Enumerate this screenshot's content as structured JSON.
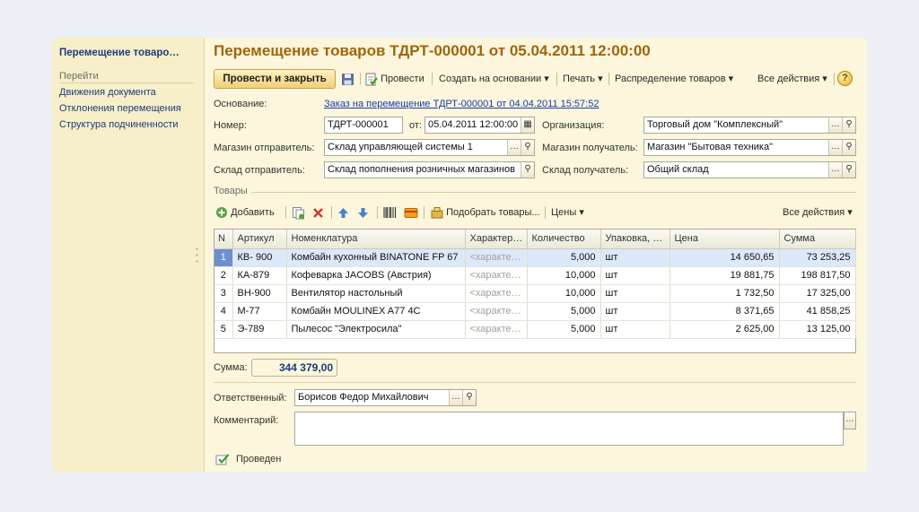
{
  "sidebar": {
    "title": "Перемещение товаро…",
    "section": "Перейти",
    "items": [
      "Движения документа",
      "Отклонения перемещения",
      "Структура подчиненности"
    ]
  },
  "window_title": "Перемещение товаров ТДРТ-000001 от 05.04.2011 12:00:00",
  "toolbar": {
    "post_close": "Провести и закрыть",
    "post": "Провести",
    "create_based": "Создать на основании",
    "print": "Печать",
    "distribution": "Распределение товаров",
    "all_actions": "Все действия",
    "help": "?"
  },
  "form": {
    "basis_label": "Основание:",
    "basis_link": "Заказ на перемещение ТДРТ-000001 от 04.04.2011 15:57:52",
    "number_label": "Номер:",
    "number_value": "ТДРТ-000001",
    "date_label": "от:",
    "date_value": "05.04.2011 12:00:00",
    "org_label": "Организация:",
    "org_value": "Торговый дом \"Комплексный\"",
    "store_from_label": "Магазин отправитель:",
    "store_from_value": "Склад управляющей системы 1",
    "store_to_label": "Магазин получатель:",
    "store_to_value": "Магазин \"Бытовая техника\"",
    "wh_from_label": "Склад отправитель:",
    "wh_from_value": "Склад пополнения розничных магазинов",
    "wh_to_label": "Склад получатель:",
    "wh_to_value": "Общий склад"
  },
  "goods": {
    "section_title": "Товары",
    "add": "Добавить",
    "pick": "Подобрать товары...",
    "prices": "Цены",
    "all_actions": "Все действия",
    "columns": [
      "N",
      "Артикул",
      "Номенклатура",
      "Характер…",
      "Количество",
      "Упаковка, …",
      "Цена",
      "Сумма"
    ],
    "rows": [
      {
        "n": "1",
        "article": "КВ- 900",
        "name": "Комбайн кухонный BINATONE FP 67",
        "char": "<характе…",
        "qty": "5,000",
        "unit": "шт",
        "price": "14 650,65",
        "sum": "73 253,25"
      },
      {
        "n": "2",
        "article": "КА-879",
        "name": "Кофеварка JACOBS (Австрия)",
        "char": "<характе…",
        "qty": "10,000",
        "unit": "шт",
        "price": "19 881,75",
        "sum": "198 817,50"
      },
      {
        "n": "3",
        "article": "ВН-900",
        "name": "Вентилятор настольный",
        "char": "<характе…",
        "qty": "10,000",
        "unit": "шт",
        "price": "1 732,50",
        "sum": "17 325,00"
      },
      {
        "n": "4",
        "article": "М-77",
        "name": "Комбайн MOULINEX  A77 4C",
        "char": "<характе…",
        "qty": "5,000",
        "unit": "шт",
        "price": "8 371,65",
        "sum": "41 858,25"
      },
      {
        "n": "5",
        "article": "Э-789",
        "name": "Пылесос \"Электросила\"",
        "char": "<характе…",
        "qty": "5,000",
        "unit": "шт",
        "price": "2 625,00",
        "sum": "13 125,00"
      }
    ]
  },
  "total": {
    "label": "Сумма:",
    "value": "344 379,00"
  },
  "responsible": {
    "label": "Ответственный:",
    "value": "Борисов Федор Михайлович"
  },
  "comment": {
    "label": "Комментарий:",
    "value": ""
  },
  "status": "Проведен"
}
